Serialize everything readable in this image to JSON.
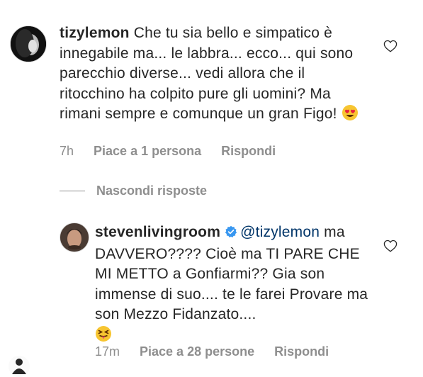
{
  "comments": [
    {
      "username": "tizylemon",
      "text": "Che tu sia bello e simpatico è innegabile ma... le labbra... ecco... qui sono parecchio diverse... vedi allora che il ritocchino ha colpito pure gli uomini? Ma rimani sempre e comunque un gran Figo!",
      "emoji_icon": "heart-eyes-emoji",
      "time": "7h",
      "likes": "Piace a 1 persona",
      "reply": "Rispondi"
    }
  ],
  "hide_replies": "Nascondi risposte",
  "replies": [
    {
      "username": "stevenlivingroom",
      "verified": true,
      "mention": "@tizylemon",
      "text": "ma DAVVERO???? Cioè ma TI PARE CHE MI METTO a Gonfiarmi?? Gia son immense di suo.... te le farei Provare ma son Mezzo Fidanzato....",
      "emoji_icon": "winking-tongue-emoji",
      "time": "17m",
      "likes": "Piace a 28 persone",
      "reply": "Rispondi"
    }
  ],
  "colors": {
    "text": "#262626",
    "muted": "#8e8e8e",
    "verified": "#3897f0",
    "emoji": "#f7c531"
  }
}
